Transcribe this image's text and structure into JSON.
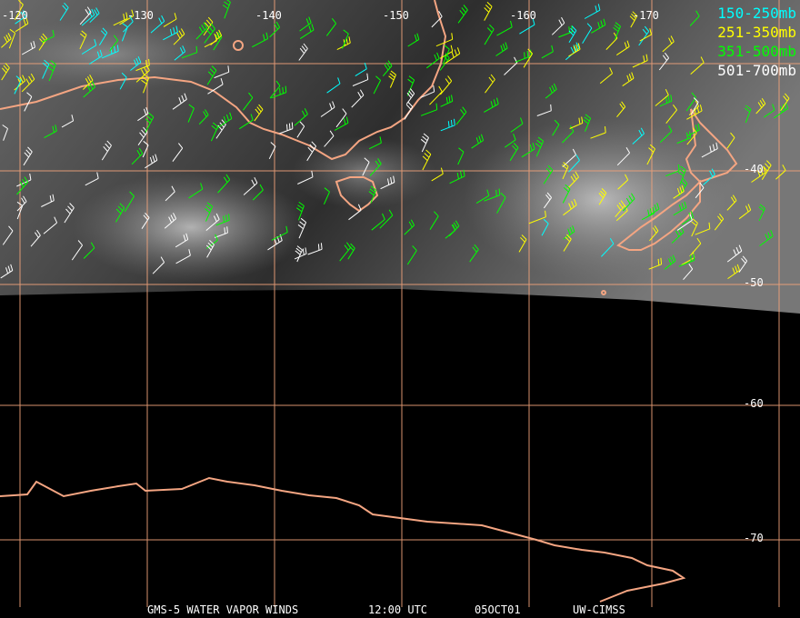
{
  "map": {
    "longitude_labels": [
      "-120",
      "-130",
      "-140",
      "-150",
      "-160",
      "-170"
    ],
    "latitude_labels": [
      "-40",
      "-50",
      "-60",
      "-70"
    ],
    "grid_color": "#f0a27a",
    "coast_color": "#f4a582"
  },
  "legend": [
    {
      "label": "150-250mb",
      "color": "#00ffff"
    },
    {
      "label": "251-350mb",
      "color": "#ffff00"
    },
    {
      "label": "351-500mb",
      "color": "#00ff00"
    },
    {
      "label": "501-700mb",
      "color": "#ffffff"
    }
  ],
  "footer": {
    "satellite": "GMS-5 WATER VAPOR WINDS",
    "time": "12:00 UTC",
    "date": "05OCT01",
    "source": "UW-CIMSS"
  }
}
